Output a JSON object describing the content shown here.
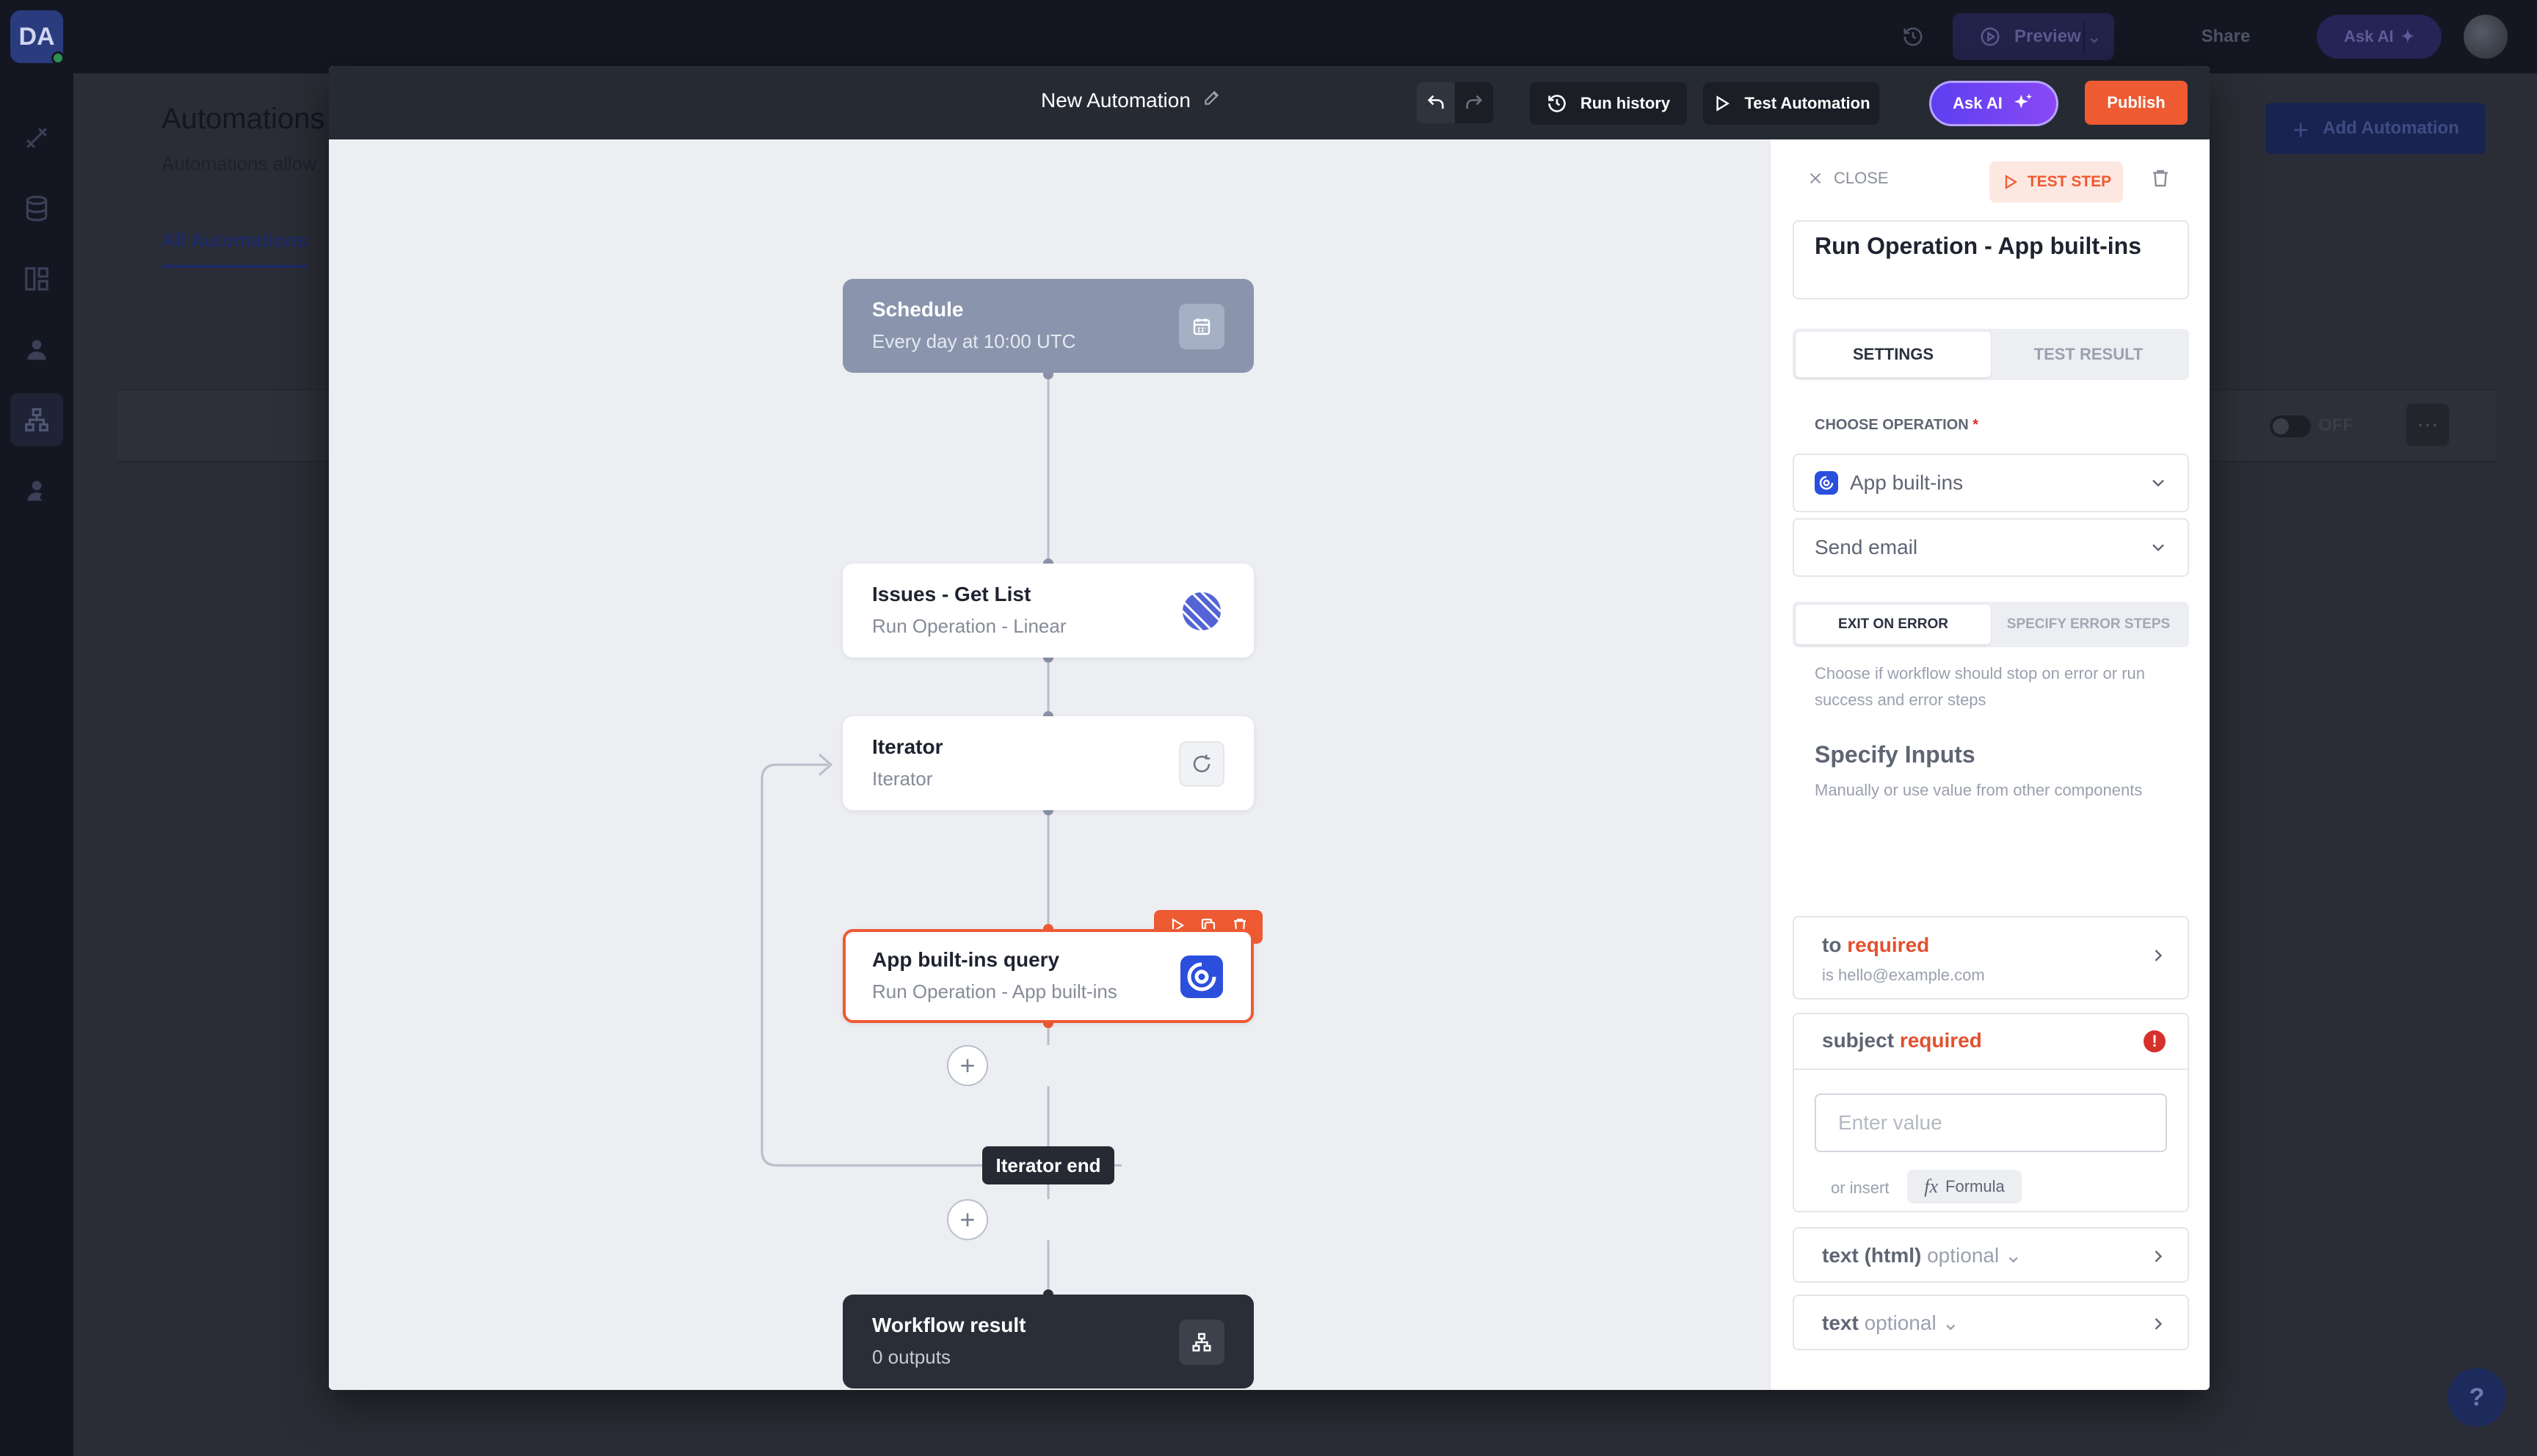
{
  "app": {
    "logo_text": "DA",
    "topbar": {
      "preview_label": "Preview",
      "share_label": "Share",
      "askai_label": "Ask AI"
    },
    "page": {
      "title": "Automations",
      "subtitle": "Automations allow",
      "tab": "All Automations",
      "add_label": "Add Automation",
      "row_toggle": "OFF"
    },
    "help_label": "?"
  },
  "modal": {
    "title": "New Automation",
    "run_history_label": "Run history",
    "test_automation_label": "Test Automation",
    "ask_ai_label": "Ask AI",
    "publish_label": "Publish"
  },
  "flow": {
    "schedule": {
      "title": "Schedule",
      "subtitle": "Every day at 10:00 UTC",
      "icon": "calendar-icon"
    },
    "issues": {
      "title": "Issues - Get List",
      "subtitle": "Run Operation - Linear",
      "icon": "linear-logo-icon"
    },
    "iterator": {
      "title": "Iterator",
      "subtitle": "Iterator",
      "icon": "refresh-icon"
    },
    "builtins": {
      "title": "App built-ins query",
      "subtitle": "Run Operation - App built-ins",
      "icon": "app-builtins-icon"
    },
    "iterator_end_label": "Iterator end",
    "result": {
      "title": "Workflow result",
      "subtitle": "0 outputs",
      "icon": "workflow-icon"
    },
    "accent_color": "#ee5a32"
  },
  "panel": {
    "close_label": "CLOSE",
    "test_step_label": "TEST STEP",
    "step_name": "Run Operation - App built-ins",
    "tabs": [
      {
        "label": "SETTINGS",
        "active": true
      },
      {
        "label": "TEST RESULT",
        "active": false
      }
    ],
    "choose_operation_label": "CHOOSE OPERATION",
    "required_marker": "*",
    "operation_app": "App built-ins",
    "operation_action": "Send email",
    "error_tabs": [
      {
        "label": "EXIT ON ERROR",
        "active": true
      },
      {
        "label": "SPECIFY ERROR STEPS",
        "active": false
      }
    ],
    "error_help": "Choose if workflow should stop on error or run success and error steps",
    "inputs_title": "Specify Inputs",
    "inputs_subtitle": "Manually or use value from other components",
    "fields": {
      "to": {
        "name": "to",
        "status": "required",
        "value": "is hello@example.com"
      },
      "subject": {
        "name": "subject",
        "status": "required",
        "placeholder": "Enter value",
        "or_insert": "or insert",
        "formula_label": "Formula",
        "formula_icon": "fx"
      },
      "text_html": {
        "name": "text (html)",
        "status": "optional"
      },
      "text": {
        "name": "text",
        "status": "optional"
      }
    }
  }
}
